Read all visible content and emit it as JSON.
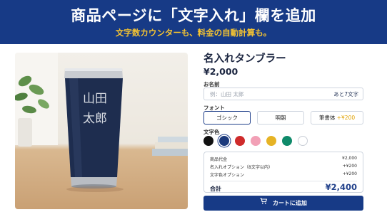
{
  "banner": {
    "title": "商品ページに「文字入れ」欄を追加",
    "subtitle": "文字数カウンターも、料金の自動計算も。"
  },
  "photo": {
    "engraving_line1": "山田",
    "engraving_line2": "太郎"
  },
  "product": {
    "name": "名入れタンブラー",
    "price": "¥2,000"
  },
  "name_field": {
    "label": "お名前",
    "placeholder": "例：山田 太郎",
    "counter": "あと7文字"
  },
  "font": {
    "label": "フォント",
    "options": [
      {
        "label": "ゴシック",
        "extra": "",
        "selected": true
      },
      {
        "label": "明朝",
        "extra": "",
        "selected": false
      },
      {
        "label": "筆書体",
        "extra": "+¥200",
        "selected": false
      }
    ]
  },
  "color": {
    "label": "文字色",
    "swatches": [
      {
        "name": "black",
        "hex": "#111111"
      },
      {
        "name": "navy",
        "hex": "#1c3a7c",
        "selected": true
      },
      {
        "name": "red",
        "hex": "#cf2b2b"
      },
      {
        "name": "pink",
        "hex": "#f2a0b6"
      },
      {
        "name": "yellow",
        "hex": "#e6b325"
      },
      {
        "name": "green",
        "hex": "#0f8a6a"
      },
      {
        "name": "white",
        "hex": "#ffffff"
      }
    ]
  },
  "summary": {
    "rows": [
      {
        "label": "商品代金",
        "value": "¥2,000"
      },
      {
        "label": "名入れオプション（8文字以内）",
        "value": "+¥200"
      },
      {
        "label": "文字色オプション",
        "value": "+¥200"
      }
    ],
    "total_label": "合計",
    "total_value": "¥2,400"
  },
  "cart_button": {
    "label": "カートに追加",
    "icon": "cart-icon"
  },
  "colors": {
    "brand": "#173a86",
    "accent": "#f6c431"
  }
}
